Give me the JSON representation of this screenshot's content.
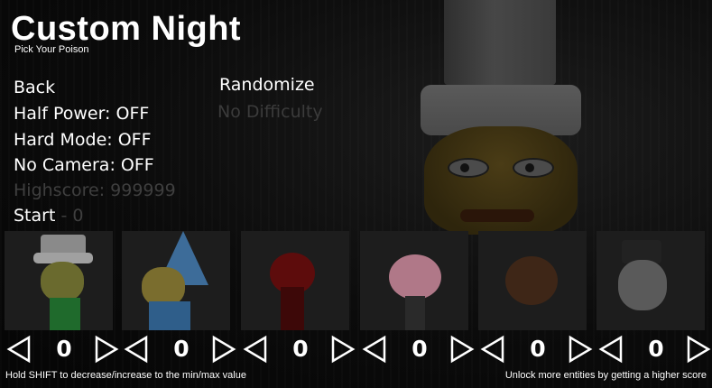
{
  "title": "Custom Night",
  "subtitle": "Pick Your Poison",
  "menu": {
    "back": "Back",
    "half_power": "Half Power: OFF",
    "hard_mode": "Hard Mode: OFF",
    "no_camera": "No Camera: OFF",
    "highscore": "Highscore: 999999",
    "start": "Start",
    "start_score": "- 0",
    "randomize": "Randomize",
    "difficulty": "No Difficulty"
  },
  "entities": [
    {
      "name": "chef-hat-entity",
      "count": "0"
    },
    {
      "name": "wizard-entity",
      "count": "0"
    },
    {
      "name": "red-blob-entity",
      "count": "0"
    },
    {
      "name": "pink-ball-entity",
      "count": "0"
    },
    {
      "name": "dim-ball-entity",
      "count": "0"
    },
    {
      "name": "pale-face-entity",
      "count": "0"
    }
  ],
  "hints": {
    "left": "Hold SHIFT to decrease/increase to the min/max value",
    "right": "Unlock more entities by getting a higher score"
  },
  "colors": {
    "background": "#0b0b0b",
    "text": "#ffffff",
    "disabled_text": "#3f3f3f",
    "card": "#1d1d1d"
  }
}
